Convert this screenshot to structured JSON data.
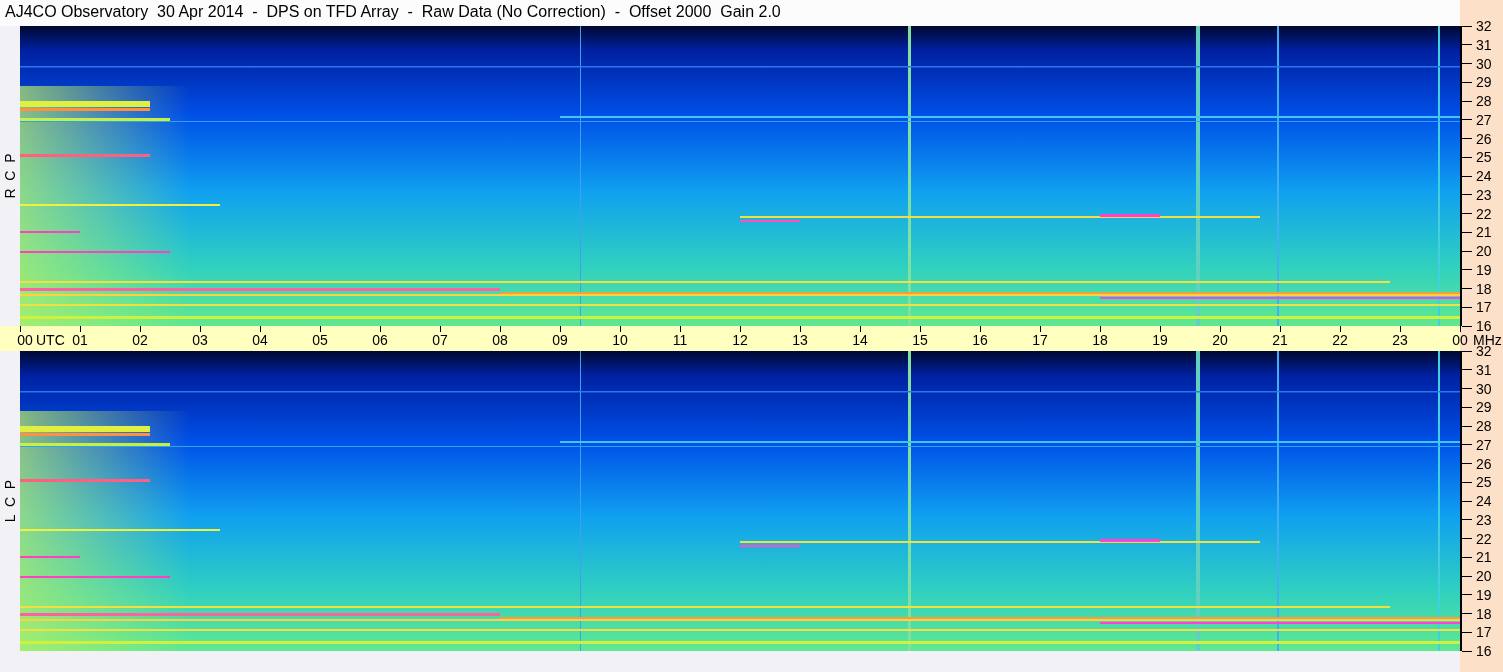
{
  "title": "AJ4CO Observatory  30 Apr 2014  -  DPS on TFD Array  -  Raw Data (No Correction)  -  Offset 2000  Gain 2.0",
  "panels": [
    {
      "label": "R  C  P",
      "freq_ticks": [
        "32",
        "31",
        "30",
        "29",
        "28",
        "27",
        "26",
        "25",
        "24",
        "23",
        "22",
        "21",
        "20",
        "19",
        "18",
        "17",
        "16"
      ]
    },
    {
      "label": "L  C  P",
      "freq_ticks": [
        "32",
        "31",
        "30",
        "29",
        "28",
        "27",
        "26",
        "25",
        "24",
        "23",
        "22",
        "21",
        "20",
        "19",
        "18",
        "17",
        "16"
      ]
    }
  ],
  "time_axis": {
    "ticks": [
      "00",
      "01",
      "02",
      "03",
      "04",
      "05",
      "06",
      "07",
      "08",
      "09",
      "10",
      "11",
      "12",
      "13",
      "14",
      "15",
      "16",
      "17",
      "18",
      "19",
      "20",
      "21",
      "22",
      "23",
      "00"
    ],
    "unit_left": "UTC",
    "unit_right": "MHz"
  }
}
